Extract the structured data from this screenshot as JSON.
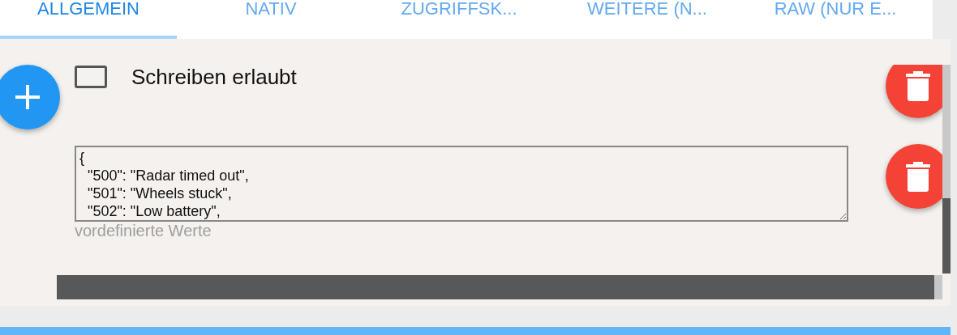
{
  "tabs": [
    {
      "label": "ALLGEMEIN",
      "selected": true
    },
    {
      "label": "NATIV",
      "selected": false
    },
    {
      "label": "ZUGRIFFSK...",
      "selected": false
    },
    {
      "label": "WEITERE (N...",
      "selected": false
    },
    {
      "label": "RAW (NUR E...",
      "selected": false
    }
  ],
  "write_allowed": {
    "label": "Schreiben erlaubt",
    "checked": false
  },
  "predefined_values": {
    "value": "{\n  \"500\": \"Radar timed out\",\n  \"501\": \"Wheels stuck\",\n  \"502\": \"Low battery\",",
    "label": "vordefinierte Werte"
  }
}
